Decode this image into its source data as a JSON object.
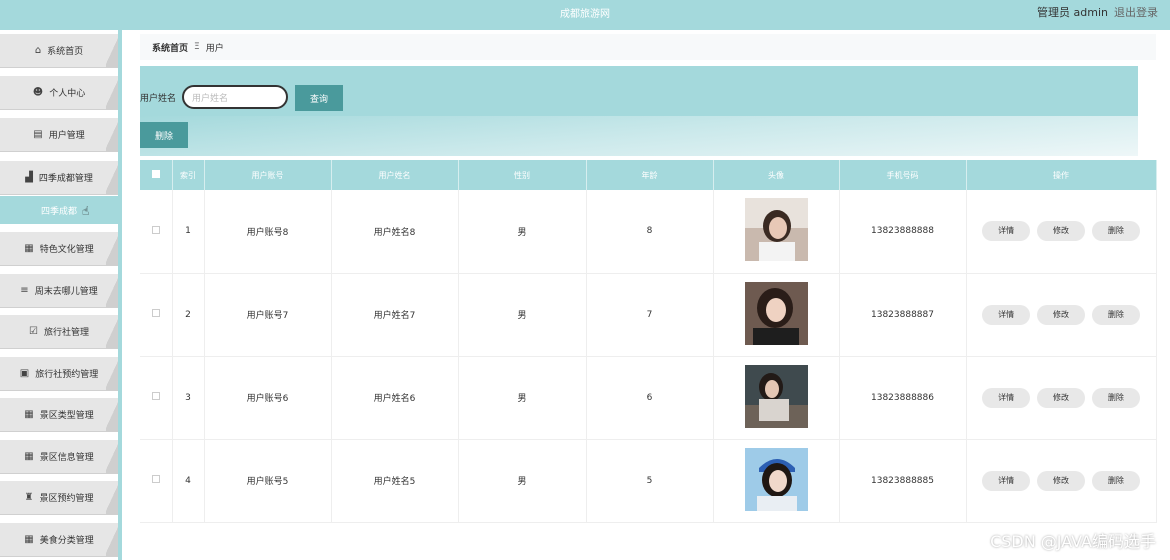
{
  "header": {
    "title": "成都旅游网",
    "user": "管理员 admin",
    "logout": "退出登录"
  },
  "sidebar": {
    "items": [
      {
        "label": "系统首页",
        "icon": "home-icon",
        "glyph": "⌂"
      },
      {
        "label": "个人中心",
        "icon": "user-icon",
        "glyph": "☻"
      },
      {
        "label": "用户管理",
        "icon": "clipboard-icon",
        "glyph": "▤"
      },
      {
        "label": "四季成都管理",
        "icon": "chart-icon",
        "glyph": "▟"
      },
      {
        "label": "特色文化管理",
        "icon": "grid-icon",
        "glyph": "▦"
      },
      {
        "label": "周末去哪儿管理",
        "icon": "sliders-icon",
        "glyph": "≡"
      },
      {
        "label": "旅行社管理",
        "icon": "checkbox-icon",
        "glyph": "☑"
      },
      {
        "label": "旅行社预约管理",
        "icon": "clipboard-check-icon",
        "glyph": "▣"
      },
      {
        "label": "景区类型管理",
        "icon": "grid-icon",
        "glyph": "▦"
      },
      {
        "label": "景区信息管理",
        "icon": "grid-icon",
        "glyph": "▦"
      },
      {
        "label": "景区预约管理",
        "icon": "trophy-icon",
        "glyph": "♜"
      },
      {
        "label": "美食分类管理",
        "icon": "grid-icon",
        "glyph": "▦"
      }
    ],
    "submenu": "四季成都"
  },
  "breadcrumb": {
    "home": "系统首页",
    "sep": "Ξ",
    "current": "用户"
  },
  "search": {
    "label": "用户姓名",
    "placeholder": "用户姓名",
    "button": "查询"
  },
  "toolbar": {
    "delete": "删除"
  },
  "table": {
    "columns": [
      "",
      "索引",
      "用户账号",
      "用户姓名",
      "性别",
      "年龄",
      "头像",
      "手机号码",
      "操作"
    ],
    "rows": [
      {
        "index": "1",
        "account": "用户账号8",
        "name": "用户姓名8",
        "gender": "男",
        "age": "8",
        "phone": "13823888888"
      },
      {
        "index": "2",
        "account": "用户账号7",
        "name": "用户姓名7",
        "gender": "男",
        "age": "7",
        "phone": "13823888887"
      },
      {
        "index": "3",
        "account": "用户账号6",
        "name": "用户姓名6",
        "gender": "男",
        "age": "6",
        "phone": "13823888886"
      },
      {
        "index": "4",
        "account": "用户账号5",
        "name": "用户姓名5",
        "gender": "男",
        "age": "5",
        "phone": "13823888885"
      }
    ],
    "actions": {
      "detail": "详情",
      "edit": "修改",
      "delete": "删除"
    }
  },
  "watermark": "CSDN @JAVA编码选手",
  "colors": {
    "accent": "#a4d9dc",
    "button": "#4a9a9c"
  }
}
